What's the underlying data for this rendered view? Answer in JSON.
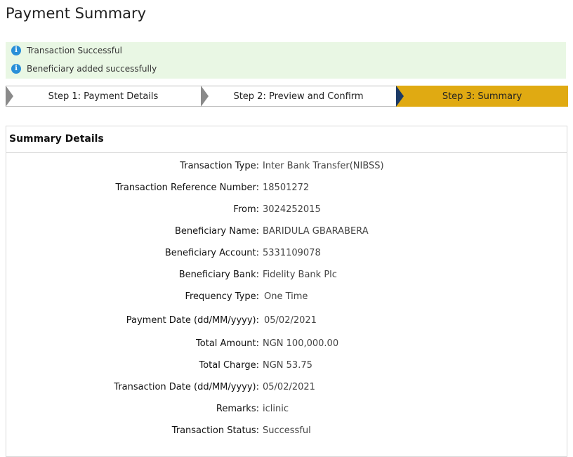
{
  "page": {
    "title": "Payment Summary"
  },
  "alerts": [
    {
      "icon": "info-icon",
      "text": "Transaction Successful"
    },
    {
      "icon": "info-icon",
      "text": "Beneficiary added successfully"
    }
  ],
  "steps": [
    {
      "label": "Step 1: Payment Details",
      "state": "done"
    },
    {
      "label": "Step 2: Preview and Confirm",
      "state": "done"
    },
    {
      "label": "Step 3: Summary",
      "state": "active"
    }
  ],
  "colors": {
    "active_step": "#e0aa12",
    "active_arrow": "#1c3a66",
    "step_arrow": "#8a8a8a",
    "alert_bg": "#e9f7e4",
    "info_icon": "#2a8fd8"
  },
  "summary": {
    "title": "Summary Details",
    "rows": [
      {
        "label": "Transaction Type:",
        "value": "Inter Bank Transfer(NIBSS)"
      },
      {
        "label": "Transaction Reference Number:",
        "value": "18501272"
      },
      {
        "label": "From:",
        "value": "3024252015"
      },
      {
        "label": "Beneficiary Name:",
        "value": "BARIDULA GBARABERA"
      },
      {
        "label": "Beneficiary Account:",
        "value": "5331109078"
      },
      {
        "label": "Beneficiary Bank:",
        "value": "Fidelity Bank Plc"
      },
      {
        "label": "Frequency Type:",
        "value": "One Time"
      },
      {
        "label": "Payment Date (dd/MM/yyyy):",
        "value": "05/02/2021"
      },
      {
        "label": "Total Amount:",
        "value": "NGN 100,000.00"
      },
      {
        "label": "Total Charge:",
        "value": "NGN 53.75"
      },
      {
        "label": "Transaction Date (dd/MM/yyyy):",
        "value": "05/02/2021"
      },
      {
        "label": "Remarks:",
        "value": "iclinic"
      },
      {
        "label": "Transaction Status:",
        "value": "Successful"
      }
    ]
  }
}
